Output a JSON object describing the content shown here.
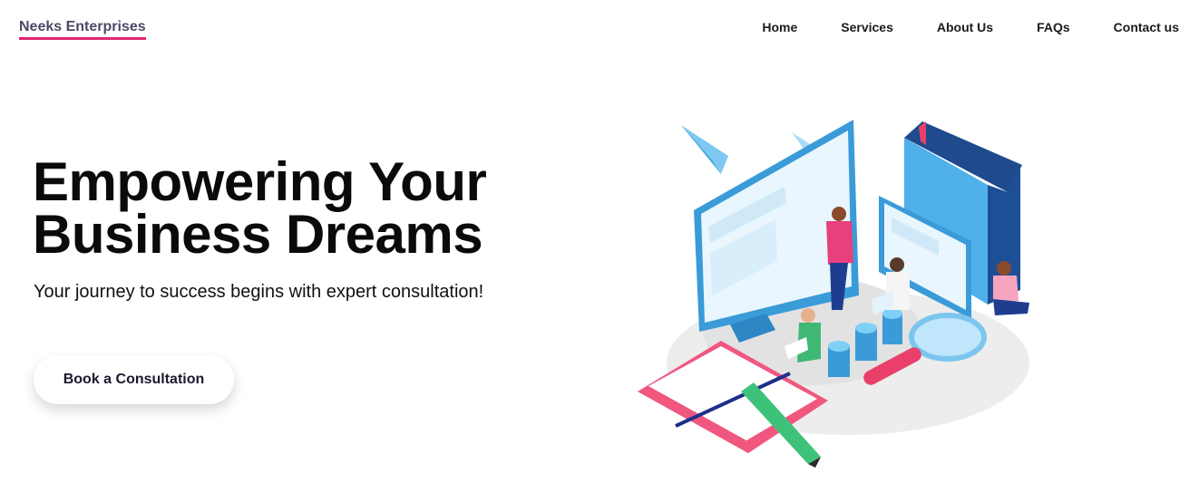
{
  "header": {
    "brand": "Neeks Enterprises",
    "nav": [
      "Home",
      "Services",
      "About Us",
      "FAQs",
      "Contact us"
    ]
  },
  "hero": {
    "title_line1": "Empowering Your",
    "title_line2": "Business Dreams",
    "subtitle": "Your journey to success begins with expert consultation!",
    "cta_label": "Book a Consultation"
  },
  "colors": {
    "accent_underline": "#e0266e",
    "illustration_blue": "#4db3ec",
    "illustration_pink": "#f0577f",
    "illustration_green": "#49c07a"
  },
  "icons": {
    "illustration": "business-consultation-isometric-illustration"
  }
}
